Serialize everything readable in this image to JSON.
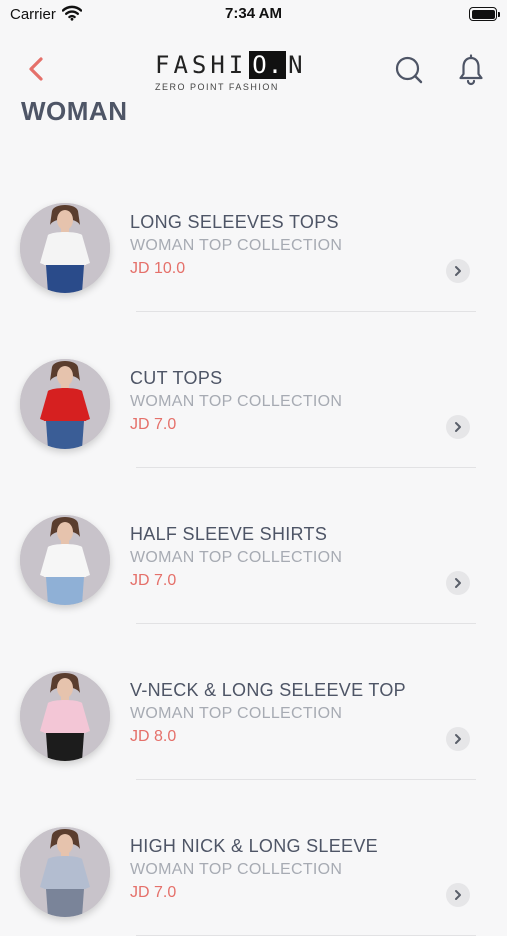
{
  "status_bar": {
    "carrier": "Carrier",
    "time": "7:34 AM"
  },
  "header": {
    "logo_left": "FASHI",
    "logo_box": "O.",
    "logo_right": "N",
    "tagline": "ZERO POINT FASHION"
  },
  "page": {
    "title": "WOMAN"
  },
  "colors": {
    "accent": "#e5706a",
    "title": "#4e5566",
    "muted": "#a7abb3"
  },
  "products": [
    {
      "name": "LONG SELEEVES TOPS",
      "collection": "WOMAN TOP COLLECTION",
      "price": "JD 10.0",
      "top_color": "#f4f4f4",
      "bottom_color": "#2a4b8a"
    },
    {
      "name": "CUT TOPS",
      "collection": "WOMAN TOP COLLECTION",
      "price": "JD 7.0",
      "top_color": "#d62020",
      "bottom_color": "#3a5d96"
    },
    {
      "name": "HALF SLEEVE SHIRTS",
      "collection": "WOMAN TOP COLLECTION",
      "price": "JD 7.0",
      "top_color": "#f6f6f6",
      "bottom_color": "#8fb0d6"
    },
    {
      "name": "V-NECK & LONG SELEEVE TOP",
      "collection": "WOMAN TOP COLLECTION",
      "price": "JD 8.0",
      "top_color": "#f3c6d6",
      "bottom_color": "#1c1c1c"
    },
    {
      "name": "HIGH NICK & LONG SLEEVE",
      "collection": "WOMAN TOP COLLECTION",
      "price": "JD 7.0",
      "top_color": "#b3bdd0",
      "bottom_color": "#7a8499"
    }
  ]
}
